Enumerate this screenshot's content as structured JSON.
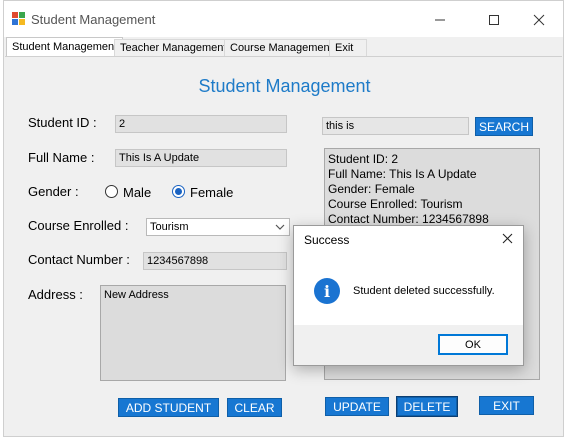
{
  "window": {
    "title": "Student Management"
  },
  "menu": {
    "tabs": [
      "Student Management",
      "Teacher Management",
      "Course Management",
      "Exit"
    ]
  },
  "form": {
    "heading": "Student Management",
    "student_id_label": "Student ID :",
    "student_id_value": "2",
    "full_name_label": "Full Name :",
    "full_name_value": "This Is A Update",
    "gender_label": "Gender :",
    "gender_options": [
      "Male",
      "Female"
    ],
    "gender_selected": "Female",
    "course_label": "Course Enrolled :",
    "course_value": "Tourism",
    "contact_label": "Contact Number :",
    "contact_value": "1234567898",
    "address_label": "Address :",
    "address_value": "New Address"
  },
  "search": {
    "value": "this is",
    "button": "SEARCH"
  },
  "details": {
    "lines": [
      "Student ID: 2",
      "Full Name: This Is A Update",
      "Gender: Female",
      "Course Enrolled: Tourism",
      "Contact Number: 1234567898"
    ]
  },
  "buttons": {
    "add": "ADD STUDENT",
    "clear": "CLEAR",
    "update": "UPDATE",
    "delete": "DELETE",
    "exit": "EXIT"
  },
  "dialog": {
    "title": "Success",
    "message": "Student deleted successfully.",
    "ok": "OK",
    "icon": "info-icon"
  },
  "colors": {
    "accent": "#1777d2",
    "heading": "#1e7bc8"
  }
}
